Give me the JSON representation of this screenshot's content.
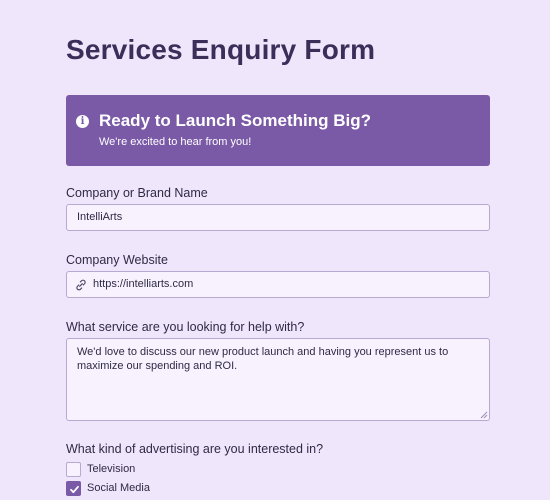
{
  "form": {
    "title": "Services Enquiry Form"
  },
  "banner": {
    "icon": "info-icon",
    "title": "Ready to Launch Something Big?",
    "subtitle": "We're excited to hear from you!",
    "color": "#7a59a6"
  },
  "fields": {
    "company_name": {
      "label": "Company or Brand Name",
      "value": "IntelliArts"
    },
    "company_website": {
      "label": "Company Website",
      "icon": "link-icon",
      "value": "https://intelliarts.com"
    },
    "service": {
      "label": "What service are you looking for help with?",
      "value": "We'd love to discuss our new product launch and having you represent us to maximize our spending and ROI."
    },
    "advertising": {
      "label": "What kind of advertising are you interested in?",
      "options": [
        {
          "label": "Television",
          "checked": false
        },
        {
          "label": "Social Media",
          "checked": true
        }
      ]
    }
  },
  "colors": {
    "background": "#efe6fb",
    "accent": "#7a59a6",
    "field_background": "#f8f2ff",
    "field_border": "#b7a9cf"
  }
}
